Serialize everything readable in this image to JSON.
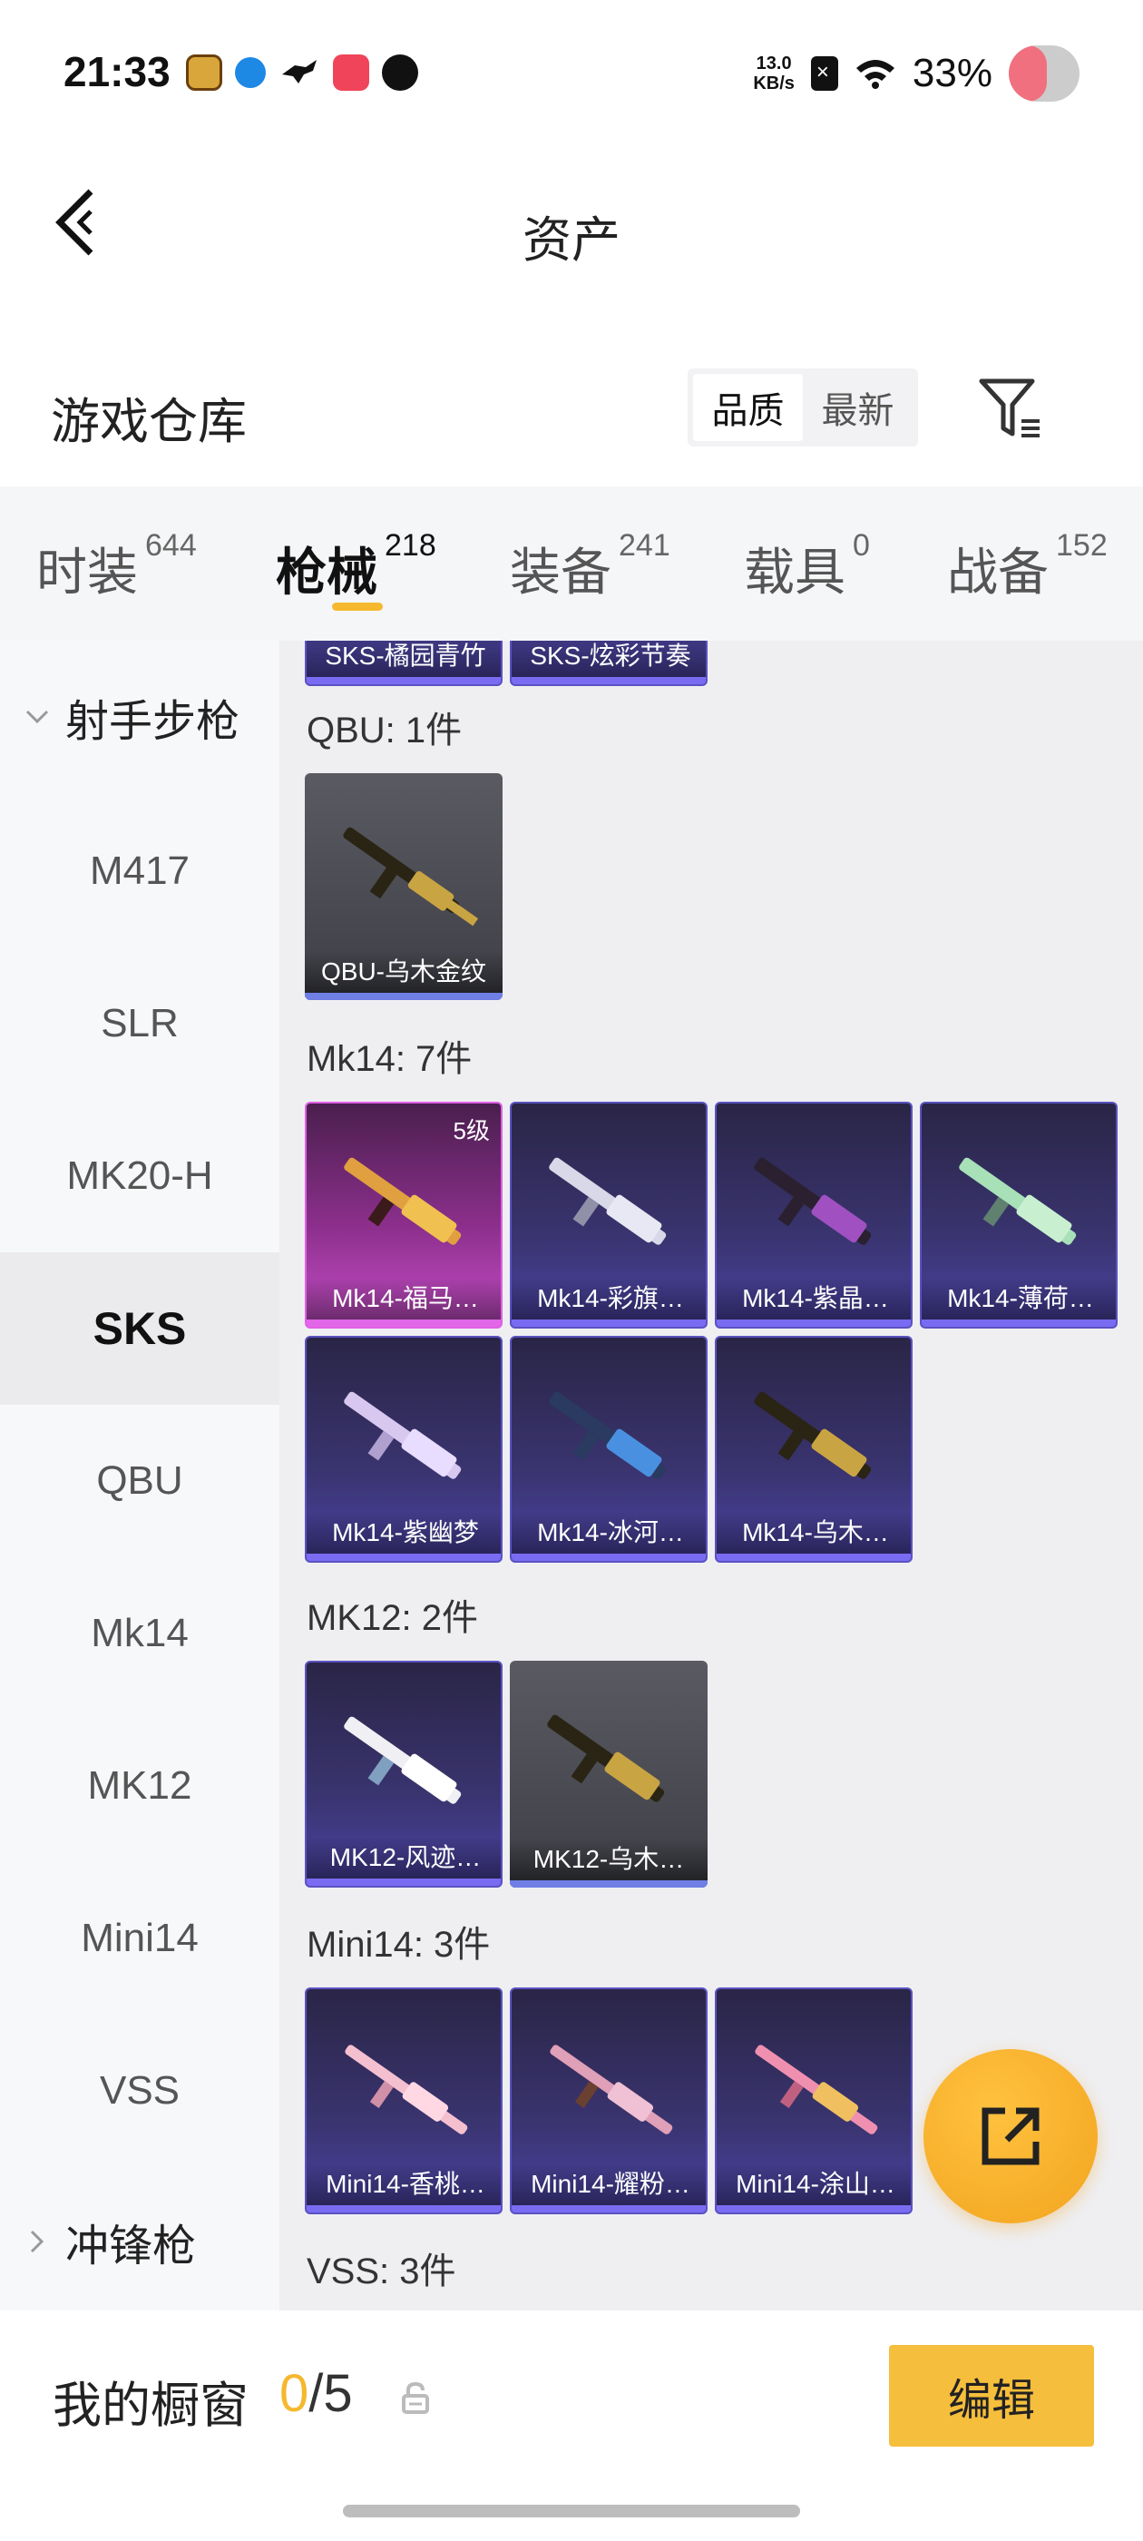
{
  "status_bar": {
    "time": "21:33",
    "speed_value": "13.0",
    "speed_unit": "KB/s",
    "battery": "33%"
  },
  "header": {
    "title": "资产"
  },
  "warehouse": {
    "title": "游戏仓库",
    "sort_options": [
      "品质",
      "最新"
    ],
    "sort_selected": "品质"
  },
  "tabs": [
    {
      "label": "时装",
      "count": "644"
    },
    {
      "label": "枪械",
      "count": "218",
      "active": true
    },
    {
      "label": "装备",
      "count": "241"
    },
    {
      "label": "载具",
      "count": "0"
    },
    {
      "label": "战备",
      "count": "152"
    }
  ],
  "sidebar": {
    "group_open": "射手步枪",
    "items": [
      "M417",
      "SLR",
      "MK20-H",
      "SKS",
      "QBU",
      "Mk14",
      "MK12",
      "Mini14",
      "VSS"
    ],
    "active_item": "SKS",
    "group_closed": "冲锋枪"
  },
  "content": {
    "partial_cards": [
      "SKS-橘园青竹",
      "SKS-炫彩节奏"
    ],
    "sections": [
      {
        "title": "QBU: 1件",
        "items": [
          {
            "name": "QBU-乌木金纹",
            "rarity": "grey"
          }
        ]
      },
      {
        "title": "Mk14: 7件",
        "items": [
          {
            "name": "Mk14-福马…",
            "rarity": "pink",
            "level": "5级"
          },
          {
            "name": "Mk14-彩旗…",
            "rarity": "purple"
          },
          {
            "name": "Mk14-紫晶…",
            "rarity": "purple"
          },
          {
            "name": "Mk14-薄荷…",
            "rarity": "purple"
          },
          {
            "name": "Mk14-紫幽梦",
            "rarity": "purple"
          },
          {
            "name": "Mk14-冰河…",
            "rarity": "purple"
          },
          {
            "name": "Mk14-乌木…",
            "rarity": "purple"
          }
        ]
      },
      {
        "title": "MK12: 2件",
        "items": [
          {
            "name": "MK12-风迹…",
            "rarity": "purple"
          },
          {
            "name": "MK12-乌木…",
            "rarity": "grey"
          }
        ]
      },
      {
        "title": "Mini14: 3件",
        "items": [
          {
            "name": "Mini14-香桃…",
            "rarity": "purple"
          },
          {
            "name": "Mini14-耀粉…",
            "rarity": "purple"
          },
          {
            "name": "Mini14-涂山…",
            "rarity": "purple"
          }
        ]
      },
      {
        "title": "VSS: 3件",
        "items": []
      }
    ]
  },
  "showcase": {
    "title": "我的橱窗",
    "current": "0",
    "separator_total": "/5",
    "edit_label": "编辑"
  },
  "colors": {
    "accent": "#f5b82e",
    "rarity_purple": "#7a6cf2",
    "rarity_pink": "#e266e8",
    "rarity_grey": "#5a5b62"
  }
}
